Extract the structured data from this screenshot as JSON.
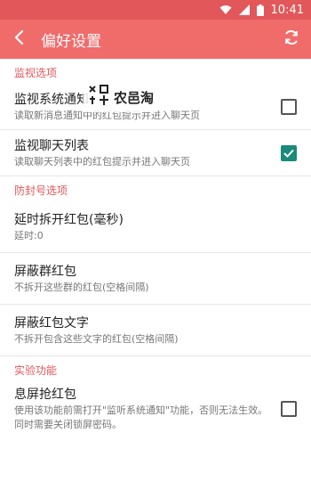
{
  "status_bar": {
    "time": "10:41"
  },
  "app_bar": {
    "title": "偏好设置"
  },
  "sections": [
    {
      "header": "监视选项",
      "items": [
        {
          "title": "监视系统通知",
          "summary": "读取新消息通知中的红包提示并进入聊天页",
          "checkbox": "unchecked"
        },
        {
          "title": "监视聊天列表",
          "summary": "读取聊天列表中的红包提示并进入聊天页",
          "checkbox": "checked"
        }
      ]
    },
    {
      "header": "防封号选项",
      "items": [
        {
          "title": "延时拆开红包(毫秒)",
          "summary": "延时:0"
        },
        {
          "title": "屏蔽群红包",
          "summary": "不拆开这些群的红包(空格间隔)"
        },
        {
          "title": "屏蔽红包文字",
          "summary": "不拆开包含这些文字的红包(空格间隔)"
        }
      ]
    },
    {
      "header": "实验功能",
      "items": [
        {
          "title": "息屏抢红包",
          "summary": "使用该功能前需打开\"监听系统通知\"功能，否则无法生效。同时需要关闭锁屏密码。",
          "checkbox": "unchecked"
        }
      ]
    }
  ],
  "watermark": {
    "text": "农邑淘"
  }
}
